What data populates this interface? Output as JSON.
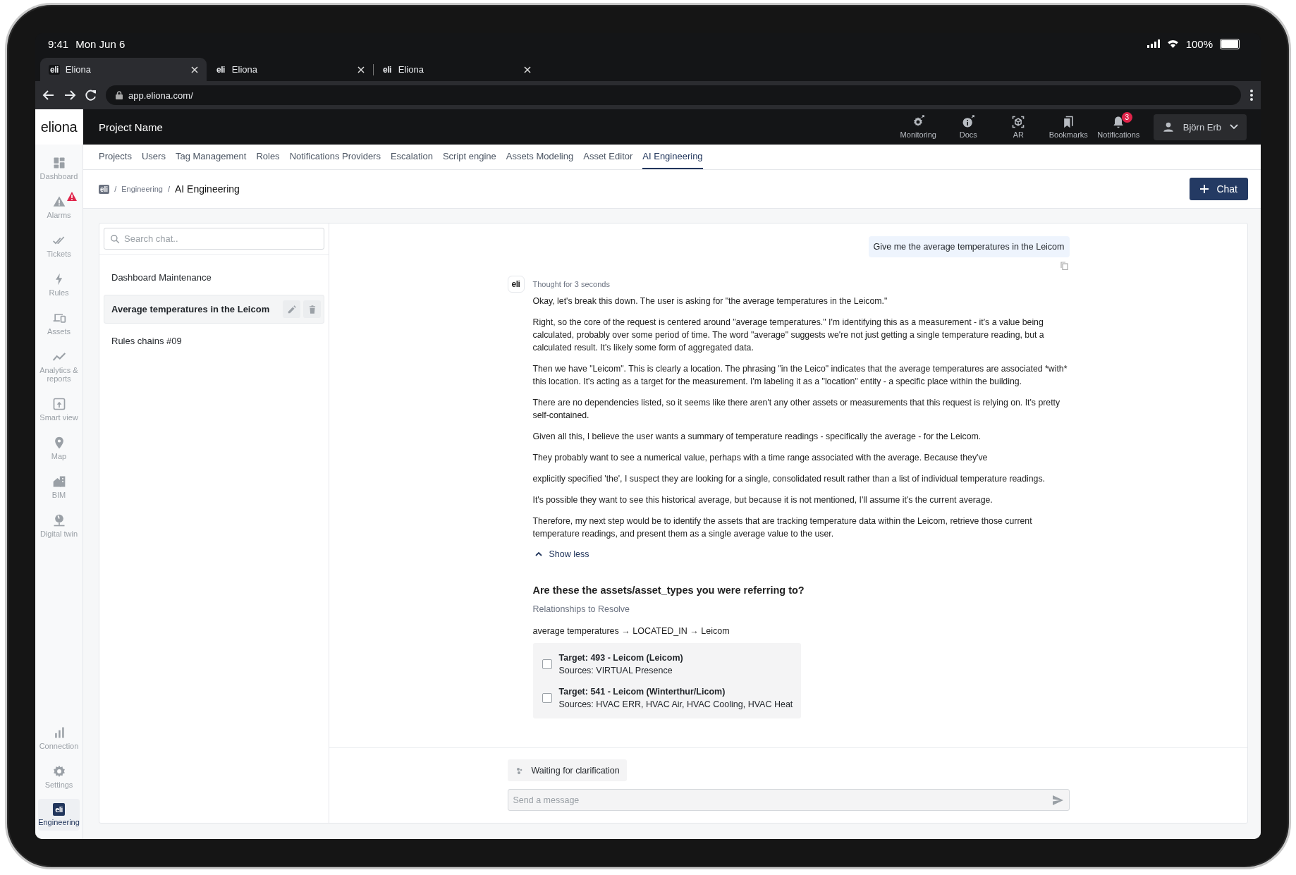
{
  "status_bar": {
    "time": "9:41",
    "date": "Mon Jun 6",
    "battery": "100%"
  },
  "browser": {
    "tabs": [
      {
        "icon": "eli",
        "title": "Eliona",
        "selected": true
      },
      {
        "icon": "eli",
        "title": "Eliona",
        "selected": false
      },
      {
        "icon": "eli",
        "title": "Eliona",
        "selected": false
      }
    ],
    "address": "app.eliona.com/"
  },
  "header": {
    "logo": "eliona",
    "project": "Project Name",
    "actions": [
      {
        "label": "Monitoring",
        "kind": "monitoring"
      },
      {
        "label": "Docs",
        "kind": "docs"
      },
      {
        "label": "AR",
        "kind": "ar"
      },
      {
        "label": "Bookmarks",
        "kind": "bookmarks"
      },
      {
        "label": "Notifications",
        "kind": "notifications",
        "badge": "3"
      }
    ],
    "user": "Björn Erb"
  },
  "sidebar": {
    "items": [
      {
        "label": "Dashboard",
        "kind": "dashboard",
        "selected": false
      },
      {
        "label": "Alarms",
        "kind": "alarms",
        "alert": true,
        "selected": false
      },
      {
        "label": "Tickets",
        "kind": "tickets",
        "selected": false
      },
      {
        "label": "Rules",
        "kind": "rules",
        "selected": false
      },
      {
        "label": "Assets",
        "kind": "assets",
        "selected": false
      },
      {
        "label": "Analytics & reports",
        "kind": "analytics",
        "selected": false
      },
      {
        "label": "Smart view",
        "kind": "smartview",
        "selected": false
      },
      {
        "label": "Map",
        "kind": "map",
        "selected": false
      },
      {
        "label": "BIM",
        "kind": "bim",
        "selected": false
      },
      {
        "label": "Digital twin",
        "kind": "twin",
        "selected": false
      }
    ],
    "bottom_items": [
      {
        "label": "Connection",
        "kind": "connection",
        "selected": false
      },
      {
        "label": "Settings",
        "kind": "settings",
        "selected": false
      },
      {
        "label": "Engineering",
        "kind": "engineering",
        "icon": "eli",
        "selected": true
      }
    ]
  },
  "nav_tabs": [
    {
      "label": "Projects",
      "selected": false
    },
    {
      "label": "Users",
      "selected": false
    },
    {
      "label": "Tag Management",
      "selected": false
    },
    {
      "label": "Roles",
      "selected": false
    },
    {
      "label": "Notifications Providers",
      "selected": false
    },
    {
      "label": "Escalation",
      "selected": false
    },
    {
      "label": "Script engine",
      "selected": false
    },
    {
      "label": "Assets Modeling",
      "selected": false
    },
    {
      "label": "Asset Editor",
      "selected": false
    },
    {
      "label": "AI Engineering",
      "selected": true
    }
  ],
  "breadcrumb": {
    "home": "eli",
    "separator": "/",
    "items": [
      "Engineering"
    ],
    "current": "AI Engineering"
  },
  "new_chat_button": "Chat",
  "chat_list": {
    "search": {
      "placeholder": "Search chat.."
    },
    "items": [
      {
        "title": "Dashboard Maintenance",
        "selected": false
      },
      {
        "title": "Average temperatures in the Leicom",
        "selected": true
      },
      {
        "title": "Rules chains #09",
        "selected": false
      }
    ]
  },
  "thread": {
    "user_message": "Give me the average temperatures in the Leicom",
    "assistant": {
      "avatar": "eli",
      "thought": "Thought for 3 seconds",
      "expanded": true,
      "toggle": "Show less",
      "paragraphs": [
        "Okay, let's break this down. The user is asking for \"the average temperatures in the Leicom.\"",
        "Right, so the core of the request is centered around \"average temperatures.\" I'm identifying this as a measurement - it's a value being calculated, probably over some period of time. The word \"average\" suggests we're not just getting a single temperature reading, but a calculated result. It's likely some form of aggregated data.",
        "Then we have \"Leicom\". This is clearly a location. The phrasing \"in the Leico\" indicates that the average temperatures are associated *with* this location. It's acting as a target for the measurement. I'm labeling it as a \"location\" entity - a specific place within the building.",
        "There are no dependencies listed, so it seems like there aren't any other assets or measurements that this request is relying on. It's pretty self-contained.",
        "Given all this, I believe the user wants a summary of temperature readings - specifically the average - for the Leicom.",
        "They probably want to see a numerical value, perhaps with a time range associated with the average. Because they've",
        "explicitly specified 'the', I suspect they are looking for a single, consolidated result rather than a list of individual temperature readings.",
        "It's possible they want to see this historical average, but because it is not mentioned, I'll assume it's the current average.",
        "Therefore, my next step would be to identify the assets that are tracking temperature data within the Leicom, retrieve those current temperature readings, and present them as a single average value to the user."
      ]
    },
    "question": {
      "title": "Are these the assets/asset_types you were referring to?",
      "subtitle": "Relationships to Resolve",
      "relation": "average temperatures → LOCATED_IN → Leicom",
      "options": [
        {
          "target": "Target: 493 - Leicom (Leicom)",
          "sources": "Sources: VIRTUAL Presence",
          "checked": false
        },
        {
          "target": "Target: 541 - Leicom (Winterthur/Licom)",
          "sources": "Sources: HVAC ERR, HVAC Air, HVAC Cooling, HVAC Heat",
          "checked": false
        }
      ]
    },
    "status": "Waiting for clarification",
    "composer": {
      "placeholder": "Send a message"
    }
  }
}
